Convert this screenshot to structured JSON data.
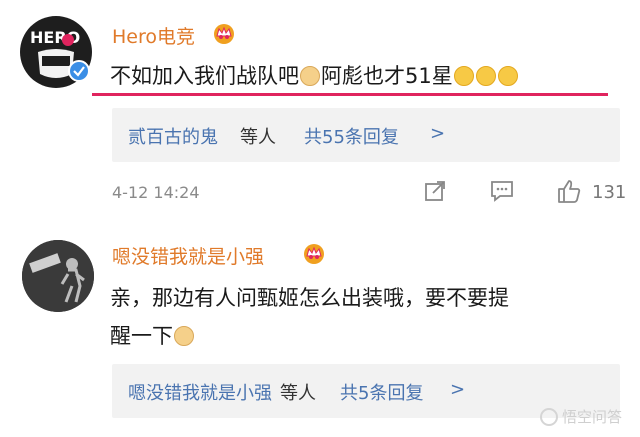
{
  "comments": [
    {
      "username": "Hero电竞",
      "avatar_text": "HERO",
      "text_parts": [
        "不如加入我们战队吧",
        "阿彪也才51星"
      ],
      "reply": {
        "names": "贰百古的鬼",
        "suffix": "等人",
        "count": "共55条回复",
        "chevron": ">"
      },
      "time": "4-12 14:24",
      "likes": "131"
    },
    {
      "username": "嗯没错我就是小强",
      "text_line1": "亲，那边有人问甄姬怎么出装哦，要不要提",
      "text_line2": "醒一下",
      "reply": {
        "names": "嗯没错我就是小强",
        "suffix": "等人",
        "count": "共5条回复",
        "chevron": ">"
      }
    }
  ],
  "watermark": "悟空问答",
  "colors": {
    "username": "#e07a2a",
    "link_blue": "#4a74b0",
    "underline": "#e0245e",
    "reply_bg": "#f2f2f2"
  },
  "icons": [
    "crown-icon",
    "verified-icon",
    "doge-emoji",
    "sweat-emoji",
    "share-icon",
    "comment-icon",
    "like-icon"
  ]
}
